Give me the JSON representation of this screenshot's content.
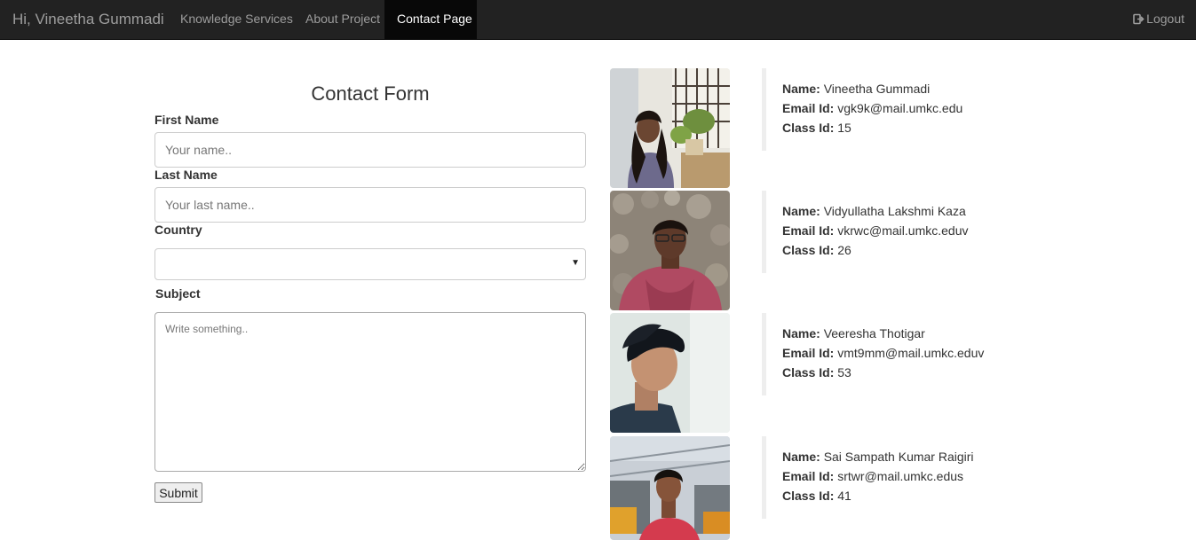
{
  "navbar": {
    "brand": "Hi, Vineetha Gummadi",
    "links": [
      {
        "label": "Knowledge Services",
        "active": false
      },
      {
        "label": "About Project",
        "active": false
      },
      {
        "label": "Contact Page",
        "active": true
      }
    ],
    "logout_label": "Logout",
    "logout_icon": "sign-out-icon"
  },
  "form": {
    "title": "Contact Form",
    "first_name": {
      "label": "First Name",
      "placeholder": "Your name..",
      "value": ""
    },
    "last_name": {
      "label": "Last Name",
      "placeholder": "Your last name..",
      "value": ""
    },
    "country": {
      "label": "Country",
      "selected": ""
    },
    "subject": {
      "label": "Subject",
      "placeholder": "Write something..",
      "value": ""
    },
    "submit_label": "Submit"
  },
  "labels": {
    "name": "Name:",
    "email": "Email Id:",
    "class": "Class Id:"
  },
  "team": [
    {
      "name": "Vineetha Gummadi",
      "email": "vgk9k@mail.umkc.edu",
      "class_id": "15"
    },
    {
      "name": "Vidyullatha Lakshmi Kaza",
      "email": "vkrwc@mail.umkc.eduv",
      "class_id": "26"
    },
    {
      "name": "Veeresha Thotigar",
      "email": "vmt9mm@mail.umkc.eduv",
      "class_id": "53"
    },
    {
      "name": "Sai Sampath Kumar Raigiri",
      "email": "srtwr@mail.umkc.edus",
      "class_id": "41"
    }
  ],
  "colors": {
    "navbar_bg": "#222222",
    "navbar_active": "#080808",
    "navbar_text": "#9d9d9d",
    "accent_border": "#eeeeee"
  }
}
